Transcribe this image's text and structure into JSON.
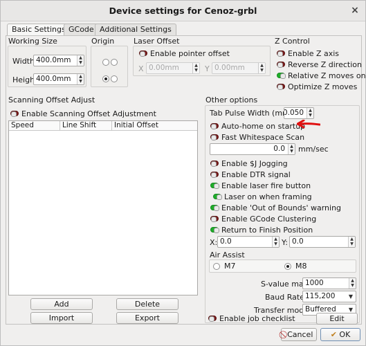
{
  "window": {
    "title": "Device settings for Cenoz-grbl",
    "close_glyph": "×"
  },
  "tabs": [
    {
      "label": "Basic Settings",
      "active": true
    },
    {
      "label": "GCode",
      "active": false
    },
    {
      "label": "Additional Settings",
      "active": false
    }
  ],
  "working_size": {
    "title": "Working Size",
    "width_label": "Width",
    "width_value": "400.0mm",
    "height_label": "Height",
    "height_value": "400.0mm"
  },
  "origin": {
    "title": "Origin",
    "selected": "bottom-left"
  },
  "laser_offset": {
    "title": "Laser Offset",
    "enable_label": "Enable pointer offset",
    "enabled": false,
    "x_label": "X",
    "x_value": "0.00mm",
    "y_label": "Y",
    "y_value": "0.00mm"
  },
  "z_control": {
    "title": "Z Control",
    "items": [
      {
        "label": "Enable Z axis",
        "on": false
      },
      {
        "label": "Reverse Z direction",
        "on": false
      },
      {
        "label": "Relative Z moves only",
        "on": true
      },
      {
        "label": "Optimize Z moves",
        "on": false
      }
    ]
  },
  "scanning": {
    "title": "Scanning Offset Adjust",
    "enable_label": "Enable Scanning Offset Adjustment",
    "enabled": false,
    "columns": [
      "Speed",
      "Line Shift",
      "Initial Offset"
    ],
    "buttons": {
      "add": "Add",
      "delete": "Delete",
      "import": "Import",
      "export": "Export"
    }
  },
  "other": {
    "title": "Other options",
    "tab_pulse_label": "Tab Pulse Width (mm)",
    "tab_pulse_value": "0.050",
    "auto_home_label": "Auto-home on startup",
    "auto_home_on": false,
    "fast_ws_label": "Fast Whitespace Scan",
    "fast_ws_on": false,
    "fast_ws_value": "0.0",
    "fast_ws_unit": "mm/sec",
    "toggles": [
      {
        "label": "Enable $J Jogging",
        "on": false
      },
      {
        "label": "Enable DTR signal",
        "on": false
      },
      {
        "label": "Enable laser fire button",
        "on": true
      },
      {
        "label": "Laser on when framing",
        "on": true
      },
      {
        "label": "Enable 'Out of Bounds' warning",
        "on": true
      },
      {
        "label": "Enable GCode Clustering",
        "on": false
      },
      {
        "label": "Return to Finish Position",
        "on": true
      }
    ],
    "x_label": "X:",
    "x_value": "0.0",
    "y_label": "Y:",
    "y_value": "0.0",
    "air_assist_title": "Air Assist",
    "air_m7": "M7",
    "air_m8": "M8",
    "air_selected": "M8",
    "s_value_label": "S-value max",
    "s_value": "1000",
    "baud_label": "Baud Rate",
    "baud_value": "115,200",
    "transfer_label": "Transfer mode",
    "transfer_value": "Buffered",
    "checklist_label": "Enable job checklist",
    "checklist_on": false,
    "edit_label": "Edit"
  },
  "footer": {
    "cancel_label": "Cancel",
    "ok_label": "OK"
  },
  "colors": {
    "toggle_on": "#1fae2a",
    "toggle_off": "#7c1a1a",
    "annotation": "#e01010"
  }
}
